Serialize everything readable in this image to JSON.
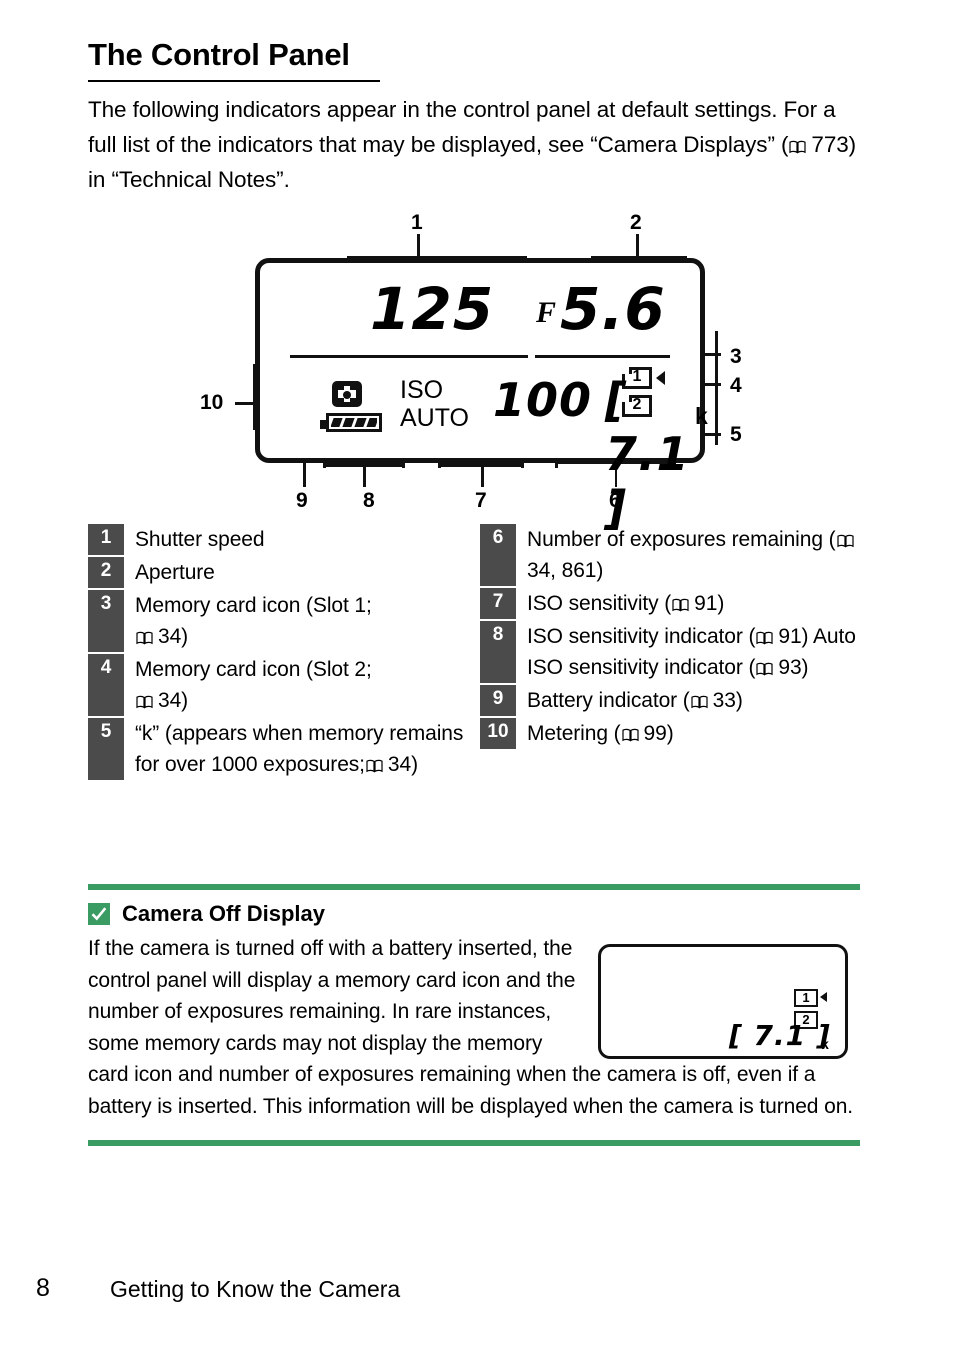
{
  "colors": {
    "accent_green": "#3a9b63",
    "badge_gray": "#4b4b4b",
    "ink": "#111111"
  },
  "header": {
    "title": "The Control Panel",
    "intro": "The following indicators appear in the control panel at default settings. For a full list of the indicators that may be displayed, see “Camera Displays” ( 773) in “Technical Notes”.",
    "intro_parts": {
      "before_ref": "The following indicators appear in the control panel at default settings. For a full list of the indicators that may be displayed, see “Camera Displays” (",
      "ref_page": "773",
      "after_ref": ") in “Technical Notes”."
    }
  },
  "figure": {
    "name": "control-panel-lcd",
    "callouts": [
      "1",
      "2",
      "3",
      "4",
      "5",
      "6",
      "7",
      "8",
      "9",
      "10"
    ],
    "lcd": {
      "shutter_speed": "125",
      "aperture_symbol": "F",
      "aperture_value": "5.6",
      "card_slot_1": "1",
      "card_slot_2": "2",
      "iso_label_line1": "ISO",
      "iso_label_line2": "AUTO",
      "iso_value": "100",
      "exposures_remaining": "[ 7.1 ]",
      "exposures_unit": "k",
      "metering_icon": "matrix-metering-icon",
      "battery_icon": "battery-full-icon"
    }
  },
  "index_list": {
    "left": [
      {
        "num": "1",
        "text": "Shutter speed"
      },
      {
        "num": "2",
        "text": "Aperture"
      },
      {
        "num": "3",
        "text": "Memory card icon (Slot 1;",
        "ref_page": "34",
        "text_after": ")"
      },
      {
        "num": "4",
        "text": "Memory card icon (Slot 2;",
        "ref_page": "34",
        "text_after": ")"
      },
      {
        "num": "5",
        "text": "“k” (appears when memory remains for over 1000 exposures;",
        "ref_page": "34",
        "text_after": ")"
      }
    ],
    "right": [
      {
        "num": "6",
        "text": "Number of exposures remaining (",
        "ref_page": "34, 861",
        "text_after": ")"
      },
      {
        "num": "7",
        "text": "ISO sensitivity (",
        "ref_page": "91",
        "text_after": ")"
      },
      {
        "num": "8",
        "text": "ISO sensitivity indicator (",
        "ref_page": "91",
        "text_after": ") Auto ISO sensitivity indicator (",
        "ref_page2": "93",
        "text_after2": ")"
      },
      {
        "num": "9",
        "text": "Battery indicator (",
        "ref_page": "33",
        "text_after": ")"
      },
      {
        "num": "10",
        "text": "Metering (",
        "ref_page": "99",
        "text_after": ")"
      }
    ]
  },
  "note": {
    "icon": "checkmark-icon",
    "title": "Camera Off Display",
    "body_top": "If the camera is turned off with a battery inserted, the control panel will display a memory card icon and the number of exposures remaining. In rare instances, some memory cards may not display the memory",
    "body_bottom": "card icon and number of exposures remaining when the camera is off, even if a battery is inserted. This information will be displayed when the camera is turned on.",
    "mini_lcd": {
      "card_slot_1": "1",
      "card_slot_2": "2",
      "exposures_remaining": "[ 7.1 ]",
      "exposures_unit": "k"
    }
  },
  "footer": {
    "page_number": "8",
    "running_head": "Getting to Know the Camera"
  }
}
